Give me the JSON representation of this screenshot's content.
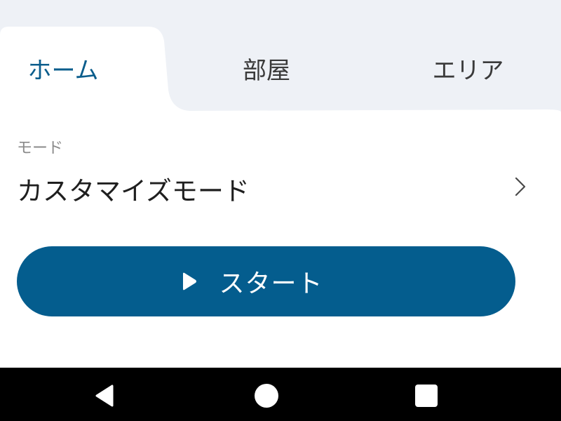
{
  "tabs": [
    {
      "label": "ホーム",
      "selected": true
    },
    {
      "label": "部屋",
      "selected": false
    },
    {
      "label": "エリア",
      "selected": false
    }
  ],
  "mode": {
    "caption": "モード",
    "value": "カスタマイズモード"
  },
  "start_button": {
    "label": "スタート",
    "icon": "play-icon"
  },
  "colors": {
    "accent": "#045d8e",
    "selected_tab_text": "#0a5d8c",
    "tab_bar_bg": "#eef1f6"
  },
  "system_nav": {
    "buttons": [
      "back-icon",
      "home-icon",
      "recent-apps-icon"
    ]
  }
}
